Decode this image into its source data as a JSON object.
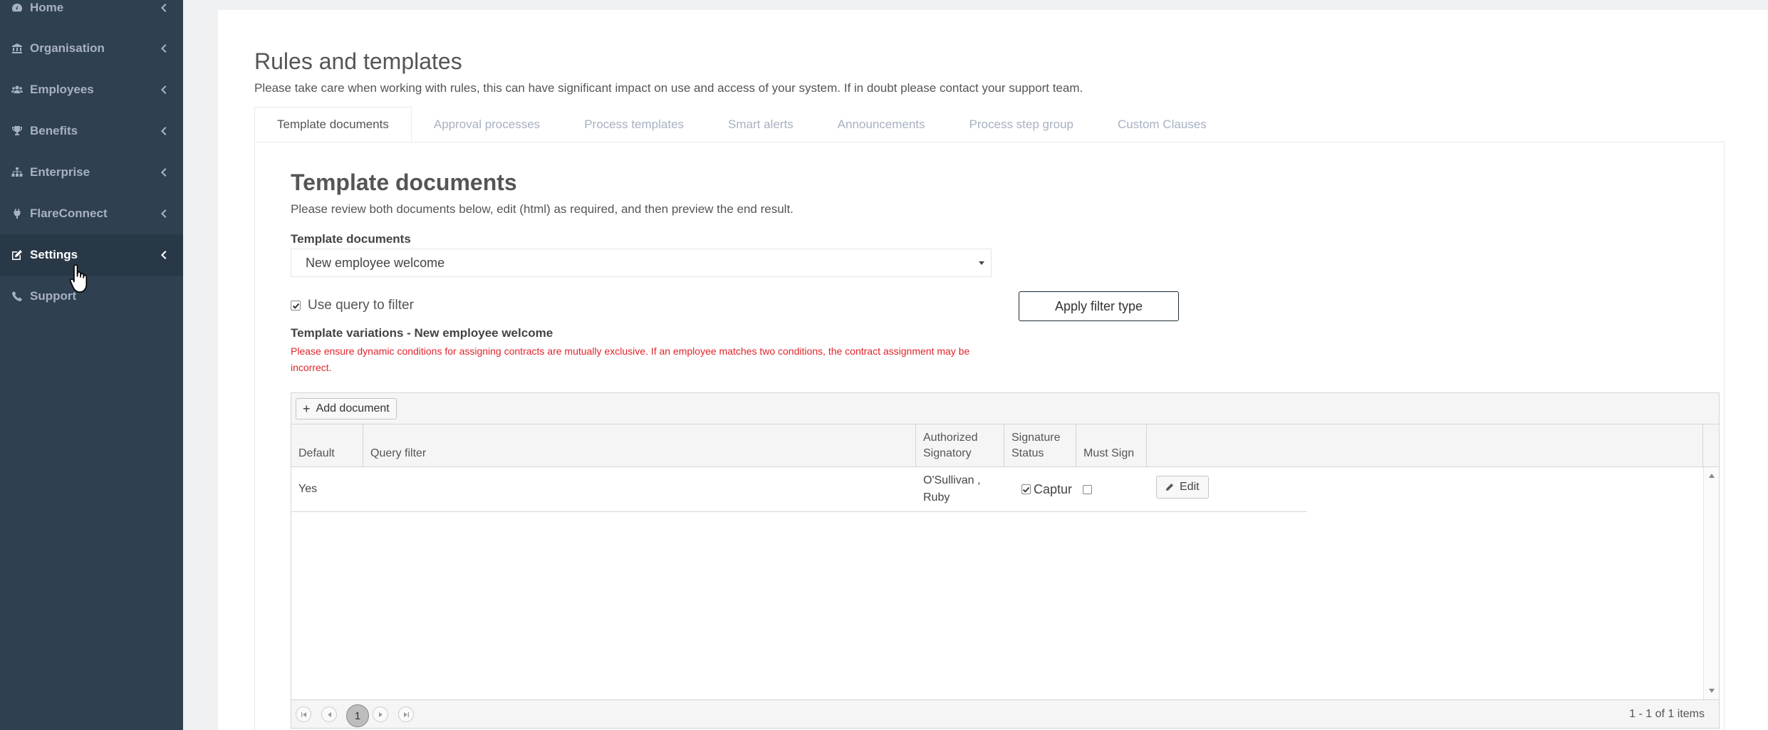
{
  "sidebar": {
    "items": [
      {
        "label": "Home",
        "icon": "dashboard-icon"
      },
      {
        "label": "Organisation",
        "icon": "institution-icon"
      },
      {
        "label": "Employees",
        "icon": "users-icon"
      },
      {
        "label": "Benefits",
        "icon": "trophy-icon"
      },
      {
        "label": "Enterprise",
        "icon": "sitemap-icon"
      },
      {
        "label": "FlareConnect",
        "icon": "plug-icon"
      },
      {
        "label": "Settings",
        "icon": "edit-icon"
      },
      {
        "label": "Support",
        "icon": "phone-icon"
      }
    ],
    "active": "Settings"
  },
  "page": {
    "title": "Rules and templates",
    "description": "Please take care when working with rules, this can have significant impact on use and access of your system. If in doubt please contact your support team."
  },
  "tabs": [
    {
      "label": "Template documents",
      "active": true
    },
    {
      "label": "Approval processes"
    },
    {
      "label": "Process templates"
    },
    {
      "label": "Smart alerts"
    },
    {
      "label": "Announcements"
    },
    {
      "label": "Process step group"
    },
    {
      "label": "Custom Clauses"
    }
  ],
  "section": {
    "title": "Template documents",
    "description": "Please review both documents below, edit (html) as required, and then preview the end result.",
    "field_label": "Template documents",
    "selected_document": "New employee welcome",
    "use_query_label": "Use query to filter",
    "use_query_checked": true,
    "apply_button": "Apply filter type",
    "variations_title": "Template variations - New employee welcome",
    "warning": "Please ensure dynamic conditions for assigning contracts are mutually exclusive. If an employee matches two conditions, the contract assignment may be incorrect."
  },
  "grid": {
    "add_button": "Add document",
    "columns": {
      "default": "Default",
      "query": "Query filter",
      "signatory_1": "Authorized",
      "signatory_2": "Signatory",
      "status_1": "Signature",
      "status_2": "Status",
      "must_sign": "Must Sign"
    },
    "rows": [
      {
        "default": "Yes",
        "query": "",
        "signatory_line1": "O'Sullivan ,",
        "signatory_line2": "Ruby",
        "status": "Captur",
        "status_checked": true,
        "must_sign": false,
        "edit_label": "Edit"
      }
    ],
    "pager": {
      "current_page": "1",
      "info": "1 - 1 of 1 items"
    }
  },
  "colors": {
    "sidebar_bg": "#2f4050",
    "sidebar_active_bg": "#293846",
    "warning": "#e0242b",
    "tab_inactive": "#a7b1c2"
  }
}
